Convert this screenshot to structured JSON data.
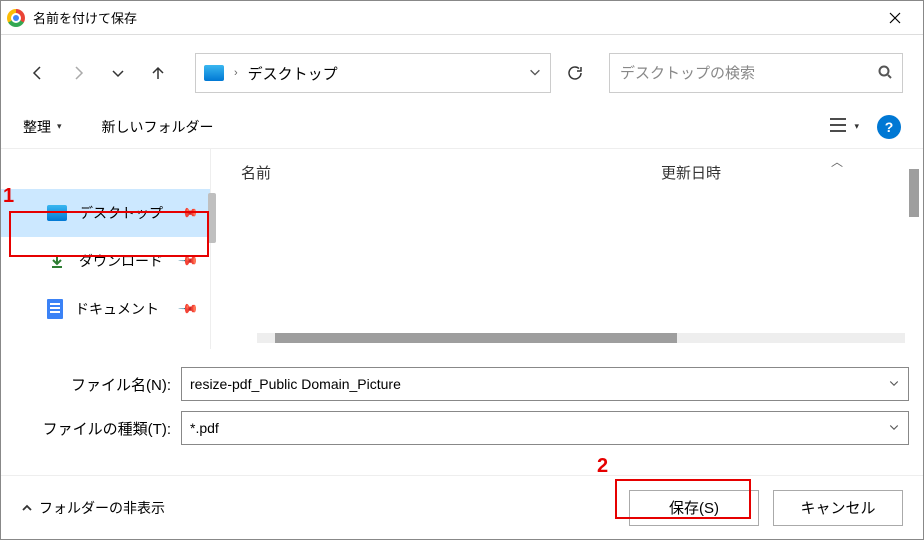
{
  "title": "名前を付けて保存",
  "path": {
    "location": "デスクトップ"
  },
  "search": {
    "placeholder": "デスクトップの検索"
  },
  "toolbar": {
    "organize": "整理",
    "newfolder": "新しいフォルダー"
  },
  "sidebar": {
    "items": [
      {
        "label": "デスクトップ"
      },
      {
        "label": "ダウンロード"
      },
      {
        "label": "ドキュメント"
      }
    ]
  },
  "columns": {
    "name": "名前",
    "date": "更新日時"
  },
  "form": {
    "filename_label": "ファイル名(N):",
    "filename_value": "resize-pdf_Public Domain_Picture",
    "filetype_label": "ファイルの種類(T):",
    "filetype_value": "*.pdf"
  },
  "footer": {
    "hide": "フォルダーの非表示",
    "save": "保存(S)",
    "cancel": "キャンセル"
  },
  "annotations": {
    "one": "1",
    "two": "2"
  }
}
